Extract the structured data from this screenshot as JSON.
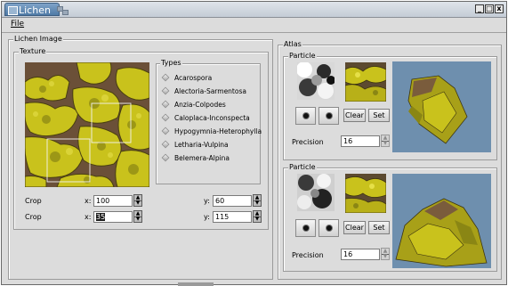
{
  "window": {
    "title": "Lichen",
    "minimize_glyph": "_",
    "maximize_glyph": "□",
    "close_glyph": "x"
  },
  "menu": {
    "file": "File"
  },
  "left_panel": {
    "title": "Lichen Image",
    "texture_title": "Texture",
    "types_title": "Types",
    "types": [
      "Acarospora",
      "Alectoria-Sarmentosa",
      "Anzia-Colpodes",
      "Caloplaca-Inconspecta",
      "Hypogymnia-Heterophylla",
      "Letharia-Vulpina",
      "Belemera-Alpina"
    ],
    "crop_rows": [
      {
        "label": "Crop",
        "x_label": "x:",
        "x_value": "100",
        "y_label": "y:",
        "y_value": "60"
      },
      {
        "label": "Crop",
        "x_label": "x:",
        "x_value": "35",
        "y_label": "y:",
        "y_value": "115"
      }
    ]
  },
  "atlas": {
    "title": "Atlas",
    "particles": [
      {
        "title": "Particle",
        "clear_label": "Clear",
        "set_label": "Set",
        "precision_label": "Precision",
        "precision_value": "16"
      },
      {
        "title": "Particle",
        "clear_label": "Clear",
        "set_label": "Set",
        "precision_label": "Precision",
        "precision_value": "16"
      }
    ]
  },
  "colors": {
    "window_bg": "#dcdcdc",
    "title_tab": "#5b84ad",
    "lichen_yellow": "#c8c21a",
    "preview_bg": "#6e8fae"
  }
}
